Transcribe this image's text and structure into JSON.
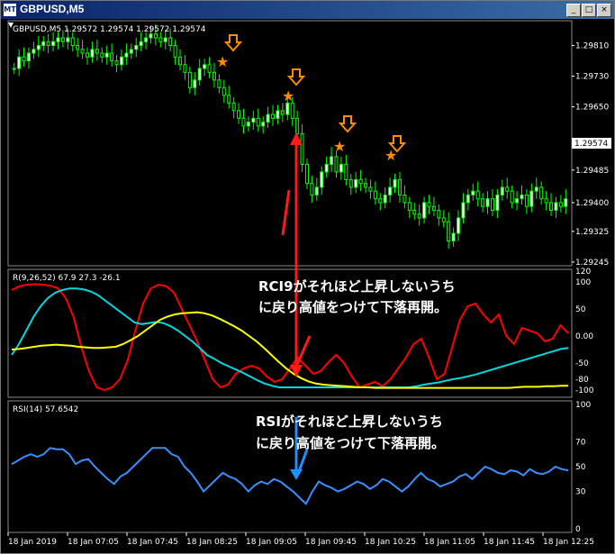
{
  "window": {
    "title": "GBPUSD,M5",
    "icon_text": "MT",
    "controls": [
      "minimize-icon",
      "maximize-icon",
      "close-icon"
    ]
  },
  "colors": {
    "background": "#000000",
    "grid": "#2a2a2a",
    "candle": "#00ff00",
    "candle_body": "#ffffff",
    "price_tag": "#ffffff",
    "rci_short": "#ff0000",
    "rci_mid": "#00d8e0",
    "rci_long": "#ffff00",
    "rsi": "#3a8fff",
    "arrow_marker": "#ff8c00",
    "red_arrow": "#ff1a1a",
    "annotation_text": "#ffffff"
  },
  "main_chart": {
    "header": "GBPUSD,M5  1.29572 1.29574 1.29572 1.29574",
    "current_price": "1.29574",
    "price_labels": [
      "1.29810",
      "1.29730",
      "1.29650",
      "1.29574",
      "1.29485",
      "1.29400",
      "1.29325",
      "1.29245"
    ]
  },
  "rci_panel": {
    "header": "R(9,26,52) 67.9 27.3 -26.1",
    "scale_labels": [
      "120",
      "100",
      "50",
      "0.00",
      "-50",
      "-80",
      "-100"
    ],
    "annotation_line1": "RCI9がそれほど上昇しないうち",
    "annotation_line2": "に戻り高値をつけて下落再開。"
  },
  "rsi_panel": {
    "header": "RSI(14) 57.6542",
    "scale_labels": [
      "100",
      "70",
      "50",
      "30",
      "0"
    ],
    "annotation_line1": "RSIがそれほど上昇しないうち",
    "annotation_line2": "に戻り高値をつけて下落再開。"
  },
  "time_axis": [
    "18 Jan 2019",
    "18 Jan 07:05",
    "18 Jan 07:45",
    "18 Jan 08:25",
    "18 Jan 09:05",
    "18 Jan 09:45",
    "18 Jan 10:25",
    "18 Jan 11:05",
    "18 Jan 11:45",
    "18 Jan 12:25"
  ],
  "chart_data": [
    {
      "type": "candlestick",
      "title": "GBPUSD,M5",
      "ylim": [
        1.2924,
        1.2987
      ],
      "y_ticks": [
        1.2981,
        1.2973,
        1.2965,
        1.29574,
        1.29485,
        1.294,
        1.29325,
        1.29245
      ],
      "close": [
        1.2975,
        1.2978,
        1.2977,
        1.2979,
        1.298,
        1.2981,
        1.2982,
        1.2981,
        1.2982,
        1.2983,
        1.2982,
        1.2983,
        1.2981,
        1.298,
        1.2979,
        1.2978,
        1.298,
        1.2979,
        1.2978,
        1.2979,
        1.2977,
        1.2976,
        1.2978,
        1.2979,
        1.298,
        1.2981,
        1.2982,
        1.2983,
        1.2984,
        1.2983,
        1.2982,
        1.2983,
        1.2981,
        1.2978,
        1.2976,
        1.2974,
        1.297,
        1.2972,
        1.2975,
        1.2976,
        1.2974,
        1.2972,
        1.297,
        1.2968,
        1.2966,
        1.2964,
        1.2962,
        1.296,
        1.2961,
        1.2962,
        1.296,
        1.2961,
        1.2963,
        1.2962,
        1.2964,
        1.2963,
        1.2966,
        1.2962,
        1.2958,
        1.295,
        1.2945,
        1.2942,
        1.2944,
        1.2948,
        1.295,
        1.2952,
        1.2948,
        1.295,
        1.2946,
        1.2944,
        1.2946,
        1.2945,
        1.2944,
        1.2943,
        1.2941,
        1.294,
        1.2942,
        1.2944,
        1.2946,
        1.2942,
        1.294,
        1.2938,
        1.2937,
        1.2936,
        1.294,
        1.2939,
        1.2938,
        1.2936,
        1.2935,
        1.293,
        1.2932,
        1.2936,
        1.294,
        1.2942,
        1.2943,
        1.2941,
        1.2939,
        1.2941,
        1.2938,
        1.2942,
        1.2944,
        1.2943,
        1.294,
        1.2941,
        1.2942,
        1.2939,
        1.2943,
        1.2944,
        1.2941,
        1.294,
        1.2938,
        1.294,
        1.2939,
        1.2941
      ]
    },
    {
      "type": "line",
      "title": "R(9,26,52)",
      "ylim": [
        -110,
        120
      ],
      "series": [
        {
          "name": "67.9",
          "values": [
            85,
            92,
            95,
            96,
            95,
            93,
            88,
            70,
            35,
            -20,
            -65,
            -95,
            -100,
            -95,
            -80,
            -45,
            10,
            60,
            88,
            95,
            92,
            80,
            50,
            20,
            -10,
            -45,
            -80,
            -95,
            -90,
            -70,
            -60,
            -55,
            -60,
            -75,
            -85,
            -80,
            -60,
            -40,
            -55,
            -70,
            -65,
            -48,
            -35,
            -50,
            -75,
            -95,
            -90,
            -85,
            -93,
            -80,
            -60,
            -40,
            -15,
            -5,
            -40,
            -80,
            -70,
            -20,
            30,
            55,
            60,
            40,
            25,
            40,
            0,
            -15,
            15,
            10,
            5,
            -10,
            -5,
            20,
            5
          ]
        },
        {
          "name": "27.3",
          "values": [
            -35,
            -15,
            10,
            35,
            55,
            70,
            80,
            85,
            88,
            88,
            86,
            82,
            75,
            65,
            55,
            45,
            35,
            25,
            22,
            24,
            26,
            24,
            18,
            10,
            0,
            -10,
            -22,
            -35,
            -42,
            -50,
            -56,
            -62,
            -68,
            -75,
            -82,
            -88,
            -92,
            -95,
            -95,
            -95,
            -95,
            -95,
            -95,
            -95,
            -95,
            -95,
            -95,
            -95,
            -95,
            -95,
            -95,
            -95,
            -95,
            -95,
            -95,
            -95,
            -93,
            -90,
            -88,
            -86,
            -83,
            -80,
            -78,
            -75,
            -72,
            -68,
            -64,
            -60,
            -56,
            -52,
            -48,
            -44,
            -40,
            -36,
            -32,
            -28,
            -24,
            -22
          ]
        },
        {
          "name": "-26.1",
          "values": [
            -25,
            -24,
            -22,
            -20,
            -18,
            -17,
            -16,
            -17,
            -18,
            -20,
            -21,
            -22,
            -22,
            -21,
            -20,
            -15,
            -8,
            0,
            10,
            20,
            30,
            36,
            40,
            42,
            43,
            44,
            42,
            38,
            32,
            25,
            18,
            10,
            0,
            -10,
            -22,
            -35,
            -48,
            -60,
            -70,
            -78,
            -84,
            -88,
            -90,
            -91,
            -92,
            -93,
            -94,
            -95,
            -95,
            -96,
            -96,
            -96,
            -96,
            -96,
            -96,
            -96,
            -96,
            -96,
            -96,
            -96,
            -96,
            -96,
            -96,
            -96,
            -96,
            -96,
            -96,
            -96,
            -95,
            -94,
            -94,
            -94,
            -93,
            -93,
            -92,
            -92
          ]
        }
      ]
    },
    {
      "type": "line",
      "title": "RSI(14)",
      "ylim": [
        0,
        100
      ],
      "series": [
        {
          "name": "57.6542",
          "values": [
            52,
            55,
            58,
            60,
            58,
            60,
            65,
            64,
            64,
            60,
            52,
            55,
            56,
            50,
            45,
            40,
            36,
            42,
            45,
            50,
            55,
            60,
            65,
            65,
            65,
            60,
            58,
            50,
            45,
            38,
            30,
            35,
            40,
            45,
            42,
            40,
            36,
            30,
            35,
            38,
            36,
            40,
            38,
            34,
            30,
            25,
            20,
            30,
            38,
            35,
            33,
            30,
            32,
            35,
            38,
            36,
            32,
            35,
            40,
            38,
            34,
            30,
            34,
            40,
            45,
            40,
            38,
            34,
            36,
            38,
            42,
            44,
            40,
            45,
            50,
            48,
            45,
            44,
            47,
            46,
            43,
            48,
            45,
            44,
            46,
            50,
            48,
            47
          ]
        }
      ]
    }
  ]
}
